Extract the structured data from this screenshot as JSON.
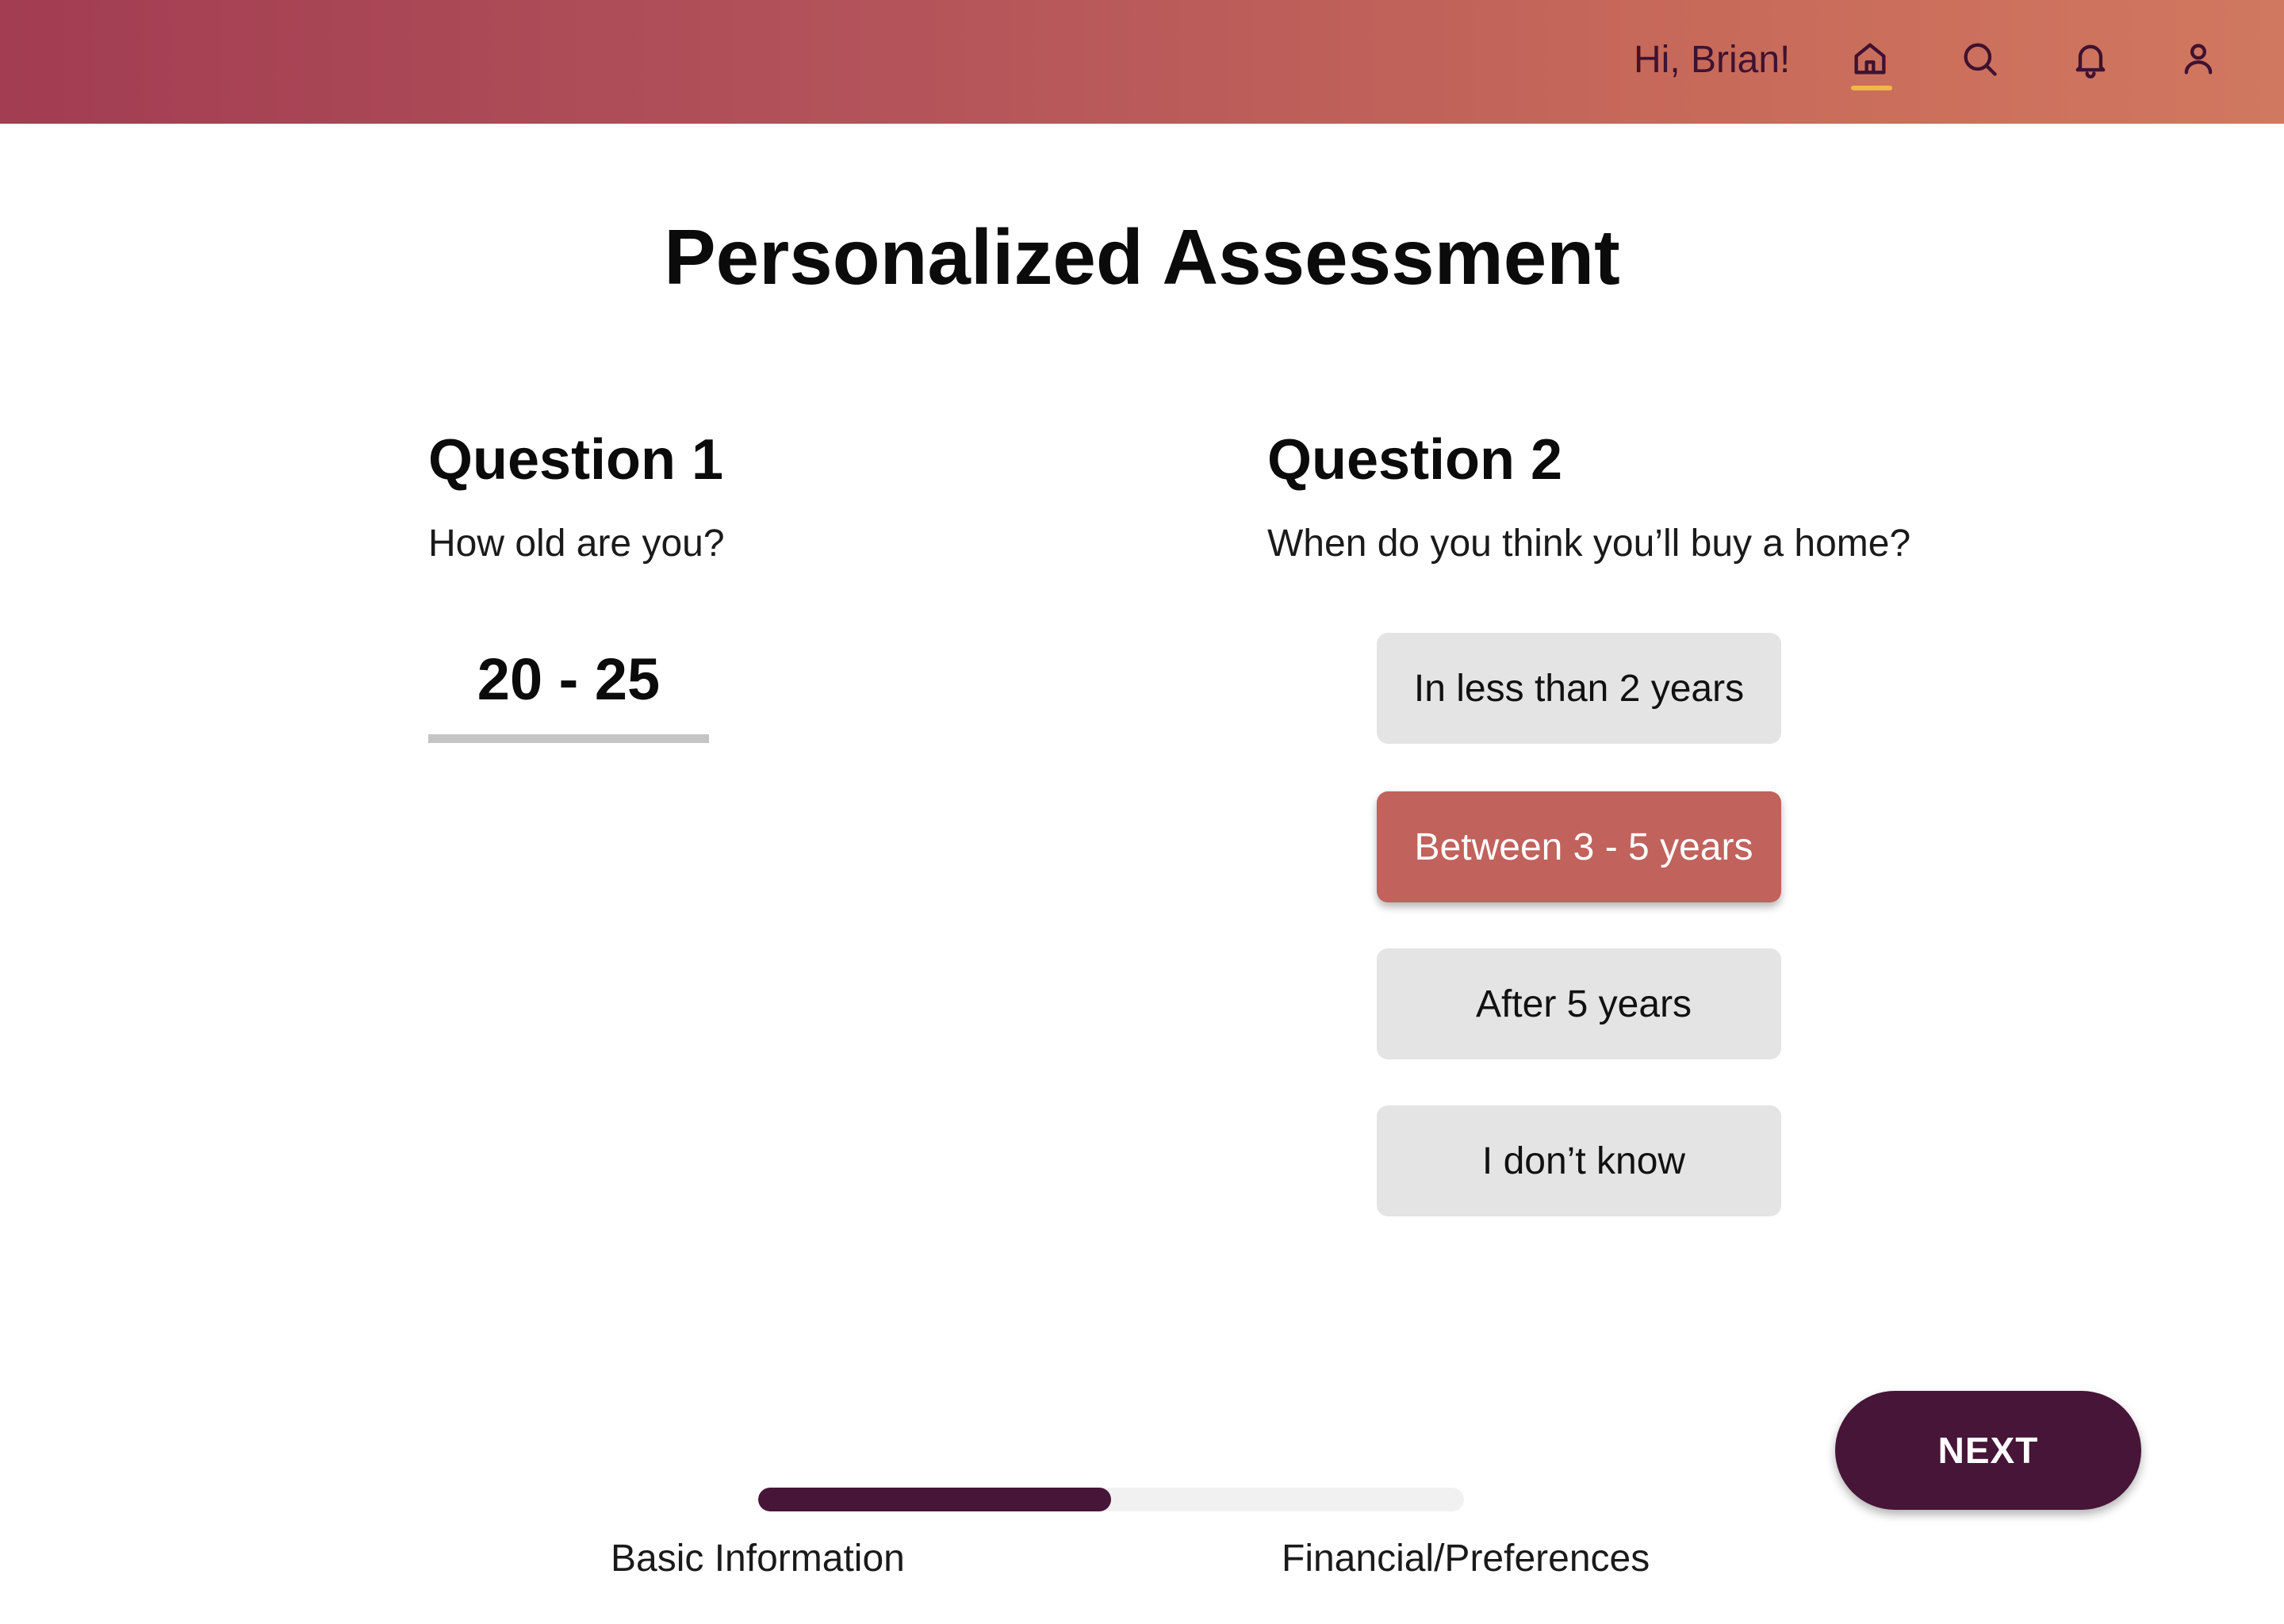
{
  "header": {
    "greeting": "Hi, Brian!",
    "icons": [
      "home-icon",
      "search-icon",
      "bell-icon",
      "user-icon"
    ],
    "active_icon": "home-icon",
    "colors": {
      "gradient_start": "#a23d52",
      "gradient_end": "#d17860",
      "icon_color": "#3f1230",
      "active_underline": "#f0b84a"
    }
  },
  "page": {
    "title": "Personalized Assessment"
  },
  "question1": {
    "heading": "Question 1",
    "text": "How old are you?",
    "value": "20 - 25"
  },
  "question2": {
    "heading": "Question 2",
    "text": "When do you think you’ll buy a home?",
    "options": [
      {
        "label": "In less than 2 years",
        "selected": false
      },
      {
        "label": "Between 3 - 5 years",
        "selected": true
      },
      {
        "label": "After 5 years",
        "selected": false
      },
      {
        "label": "I don’t know",
        "selected": false
      }
    ],
    "colors": {
      "option_bg": "#e4e4e4",
      "selected_bg": "#c1625c"
    }
  },
  "actions": {
    "next_label": "NEXT",
    "next_color": "#461537"
  },
  "progress": {
    "fraction": 0.5,
    "steps": [
      "Basic Information",
      "Financial/Preferences"
    ]
  }
}
